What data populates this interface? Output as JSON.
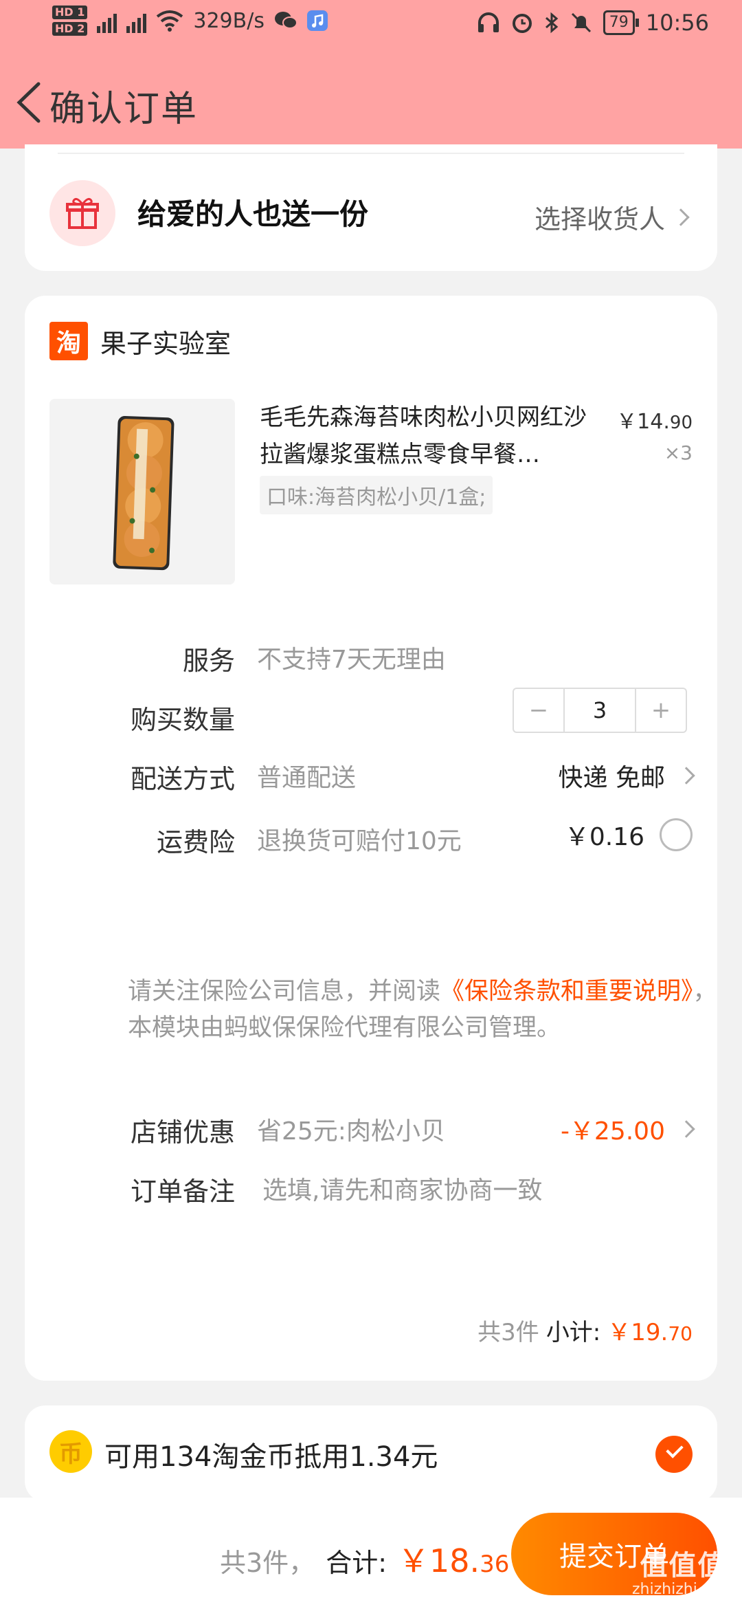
{
  "status_bar": {
    "network_speed": "329B/s",
    "battery": "79",
    "time": "10:56"
  },
  "header": {
    "title": "确认订单"
  },
  "gift": {
    "title": "给爱的人也送一份",
    "action": "选择收货人"
  },
  "shop": {
    "logo": "淘",
    "name": "果子实验室"
  },
  "product": {
    "title": "毛毛先森海苔味肉松小贝网红沙拉酱爆浆蛋糕点零食早餐…",
    "variant": "口味:海苔肉松小贝/1盒;",
    "price_main": "￥14.",
    "price_decimal": "90",
    "quantity": "×3"
  },
  "rows": {
    "service": {
      "label": "服务",
      "value": "不支持7天无理由"
    },
    "quantity": {
      "label": "购买数量",
      "value": "3",
      "minus": "−",
      "plus": "+"
    },
    "delivery": {
      "label": "配送方式",
      "value": "普通配送",
      "right": "快递 免邮"
    },
    "insurance": {
      "label": "运费险",
      "value": "退换货可赔付10元",
      "price": "￥0.16"
    },
    "discount": {
      "label": "店铺优惠",
      "value": "省25元:肉松小贝",
      "amount": "-￥25.00"
    },
    "note": {
      "label": "订单备注",
      "placeholder": "选填,请先和商家协商一致"
    }
  },
  "notice": {
    "prefix": "请关注保险公司信息，并阅读",
    "link": "《保险条款和重要说明》",
    "suffix": "，本模块由蚂蚁保保险代理有限公司管理。"
  },
  "subtotal": {
    "count": "共3件",
    "label": "小计:",
    "price_main": "￥19.",
    "price_decimal": "70"
  },
  "coins": {
    "icon": "币",
    "text": "可用134淘金币抵用1.34元"
  },
  "footer": {
    "count": "共3件，",
    "total_label": "合计:",
    "total_main": "￥18.",
    "total_decimal": "36",
    "submit": "提交订单"
  },
  "watermark": {
    "main": "值值值",
    "sub": "zhizhizhi.com"
  },
  "colors": {
    "header_bg": "#ffa3a3",
    "accent": "#ff5000"
  }
}
